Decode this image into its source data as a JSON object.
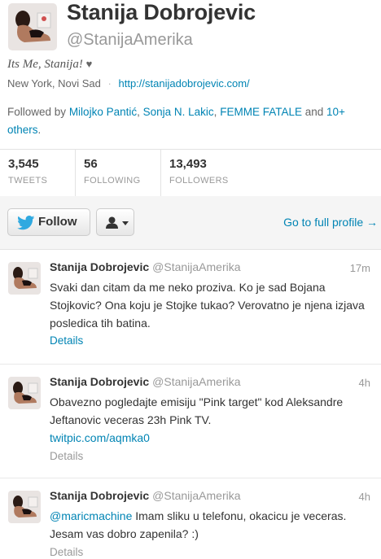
{
  "profile": {
    "name": "Stanija Dobrojevic",
    "handle": "@StanijaAmerika",
    "bio": "Its Me, Stanija!",
    "bio_heart": "♥",
    "location": "New York, Novi Sad",
    "separator": "·",
    "website": "http://stanijadobrojevic.com/",
    "followed_prefix": "Followed by",
    "followed_names": [
      "Milojko Pantić",
      "Sonja N. Lakic",
      "FEMME FATALE"
    ],
    "followed_sep1": ",",
    "followed_sep2": ",",
    "followed_and": "and",
    "followed_others": "10+ others",
    "followed_end": "."
  },
  "stats": [
    {
      "value": "3,545",
      "label": "TWEETS"
    },
    {
      "value": "56",
      "label": "FOLLOWING"
    },
    {
      "value": "13,493",
      "label": "FOLLOWERS"
    }
  ],
  "actions": {
    "follow_label": "Follow",
    "full_profile_label": "Go to full profile →"
  },
  "tweets": [
    {
      "name": "Stanija Dobrojevic",
      "handle": "@StanijaAmerika",
      "time": "17m",
      "text": "Svaki dan citam da me neko proziva. Ko je sad Bojana Stojkovic? Ona koju je Stojke tukao? Verovatno je njena izjava posledica tih batina.",
      "details": "Details"
    },
    {
      "name": "Stanija Dobrojevic",
      "handle": "@StanijaAmerika",
      "time": "4h",
      "text": "Obavezno pogledajte emisiju \"Pink target\" kod Aleksandre Jeftanovic veceras 23h Pink TV.",
      "link": "twitpic.com/aqmka0",
      "details": "Details"
    },
    {
      "name": "Stanija Dobrojevic",
      "handle": "@StanijaAmerika",
      "time": "4h",
      "mention": "@maricmachine",
      "text": " Imam sliku u telefonu, okacicu je veceras. Jesam vas dobro zapenila? :)",
      "details": "Details"
    }
  ],
  "colors": {
    "link": "#0084b4",
    "muted": "#999999",
    "text": "#333333",
    "action_bar_bg": "#f5f5f5"
  }
}
